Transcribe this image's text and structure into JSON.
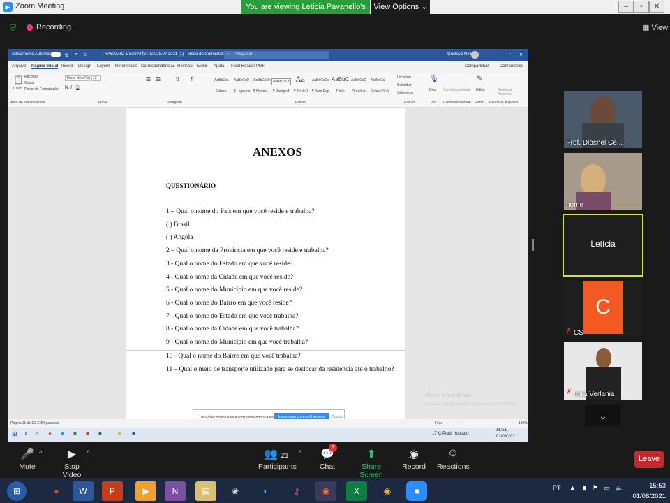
{
  "zoom": {
    "app_title": "Zoom Meeting",
    "viewing_banner": "You are viewing Letícia Pavanello's screen",
    "view_options": "View Options",
    "recording": "Recording",
    "view": "View"
  },
  "word": {
    "title_left": "Salvamento Automático",
    "doc_title": "TRABALHO 1 ESTATÍSTICA 29.07.2021 (1) - Modo de Compatibilidade - Word",
    "search": "Pesquisar",
    "user": "Gustavo Neil",
    "tabs": [
      "Arquivo",
      "Página Inicial",
      "Inserir",
      "Design",
      "Layout",
      "Referências",
      "Correspondências",
      "Revisão",
      "Exibir",
      "Ajuda",
      "Foxit Reader PDF"
    ],
    "share": "Compartilhar",
    "comments": "Comentários",
    "clipboard": {
      "paste": "Colar",
      "cut": "Recortar",
      "copy": "Copiar",
      "painter": "Pincel de Formatação",
      "group": "Área de Transferência"
    },
    "font": {
      "name": "Times New Ro",
      "size": "12",
      "group": "Fonte"
    },
    "paragraph_group": "Parágrafo",
    "styles": [
      {
        "sample": "AaBbCcL",
        "label": "Ênfase"
      },
      {
        "sample": "AaBbCcD",
        "label": "¶ Legenda"
      },
      {
        "sample": "AaBbCcDc",
        "label": "¶ Normal"
      },
      {
        "sample": "AaBbCcDc",
        "label": "¶ Parágraf..."
      },
      {
        "sample": "Aa",
        "label": "¶ Título 1"
      },
      {
        "sample": "AaBbCcDc",
        "label": "¶ Sem Esp..."
      },
      {
        "sample": "AaBbC",
        "label": "Título"
      },
      {
        "sample": "AaBbCcD",
        "label": "Subtítulo"
      },
      {
        "sample": "AaBbCcL",
        "label": "Ênfase Sutil"
      }
    ],
    "styles_group": "Estilos",
    "editing": {
      "find": "Localizar",
      "replace": "Substituir",
      "select": "Selecionar",
      "group": "Edição"
    },
    "voice": {
      "dictate": "Ditar",
      "group": "Voz"
    },
    "sensitivity": {
      "label": "Confidencialidade",
      "group": "Confidencialidade"
    },
    "editor": {
      "label": "Editor",
      "group": "Editor"
    },
    "reuse": {
      "label": "Reutilizar Arquivos",
      "group": "Reutilizar Arquivos"
    },
    "status": {
      "page": "Página 11 de 12",
      "words": "3754 palavras",
      "focus": "Foco",
      "zoom": "130%"
    },
    "taskbar": {
      "weather": "17°C  Pred. nublado",
      "time": "16:51",
      "date": "01/08/2021"
    }
  },
  "document": {
    "heading": "ANEXOS",
    "subheading": "QUESTIONÁRIO",
    "lines": [
      "1 – Qual o nome do País em que você reside e trabalha?",
      "(  ) Brasil",
      "(  ) Angola",
      "2 – Qual o nome da Província em que você reside e trabalha?",
      "3 - Qual o nome do Estado em que você reside?",
      "4 - Qual o nome da Cidade em que você reside?",
      "5 - Qual o nome do Município em que você reside?",
      "6 - Qual o nome do Bairro em que você reside?",
      "7 - Qual o nome do Estado em que você trabalha?",
      "8 - Qual o nome da Cidade em que você trabalha?",
      "9 - Qual o nome do Município em que você trabalha?",
      "10 - Qual o nome do Bairro em que você trabalha?",
      "11 – Qual o meio de transporte utilizado para se deslocar da residência até o trabalho?"
    ]
  },
  "activate": {
    "title": "Ativar o Windows",
    "sub": "Acesse Configurações para ativar o Windows."
  },
  "share_note": {
    "text": "O us02web.zoom.us está compartilhando sua tela.",
    "stop": "Interromper compartilhamento",
    "hide": "Ocultar"
  },
  "participants": [
    {
      "name": "Prof. Diosnel Ce..."
    },
    {
      "name": "home"
    },
    {
      "name": "Letícia"
    },
    {
      "name": "CS",
      "initial": "C"
    },
    {
      "name": "Inirá Verlania"
    }
  ],
  "toolbar": {
    "mute": "Mute",
    "stop_video": "Stop Video",
    "participants": "Participants",
    "participants_count": "21",
    "chat": "Chat",
    "chat_badge": "3",
    "share": "Share Screen",
    "record": "Record",
    "reactions": "Reactions",
    "leave": "Leave"
  },
  "taskbar": {
    "lang": "PT",
    "time": "15:53",
    "date": "01/08/2021"
  }
}
